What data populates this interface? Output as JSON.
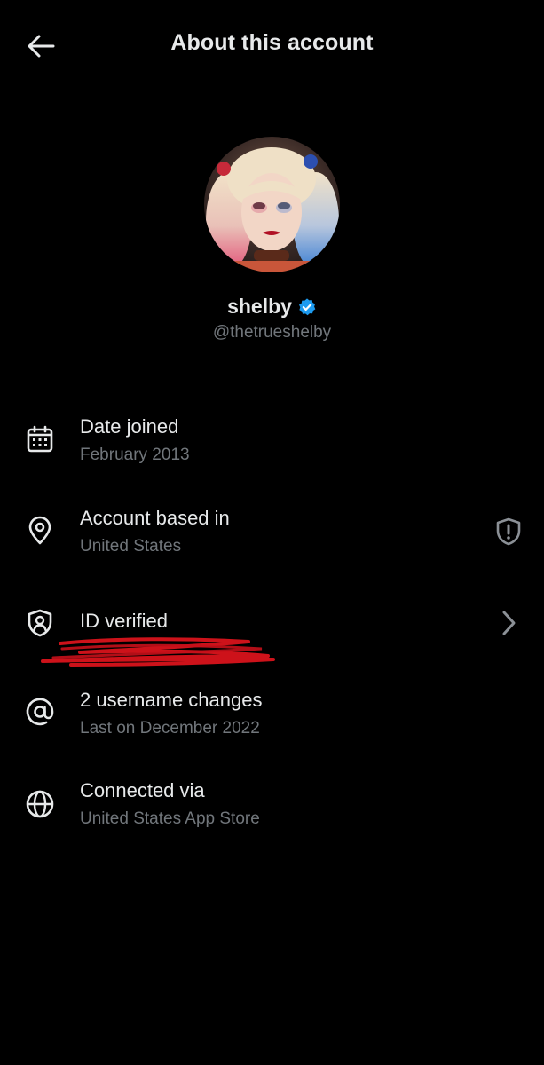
{
  "header": {
    "back_icon": "arrow-left-icon",
    "title": "About this account"
  },
  "profile": {
    "display_name": "shelby",
    "handle": "@thetrueshelby",
    "verified_icon": "verified-badge-icon",
    "verified_color": "#1d9bf0",
    "avatar_icon": "profile-photo"
  },
  "rows": [
    {
      "icon": "calendar-icon",
      "title": "Date joined",
      "subtitle": "February 2013"
    },
    {
      "icon": "location-pin-icon",
      "title": "Account based in",
      "subtitle": "United States",
      "trailing_icon": "shield-exclamation-icon"
    },
    {
      "icon": "id-shield-icon",
      "title": "ID verified",
      "trailing_icon": "chevron-right-icon"
    },
    {
      "icon": "at-sign-icon",
      "title": "2 username changes",
      "subtitle": "Last on December 2022"
    },
    {
      "icon": "globe-icon",
      "title": "Connected via",
      "subtitle": "United States App Store"
    }
  ],
  "colors": {
    "background": "#000000",
    "primary_text": "#e7e9ea",
    "secondary_text": "#71767b",
    "accent": "#1d9bf0",
    "scribble": "#d8131b"
  }
}
